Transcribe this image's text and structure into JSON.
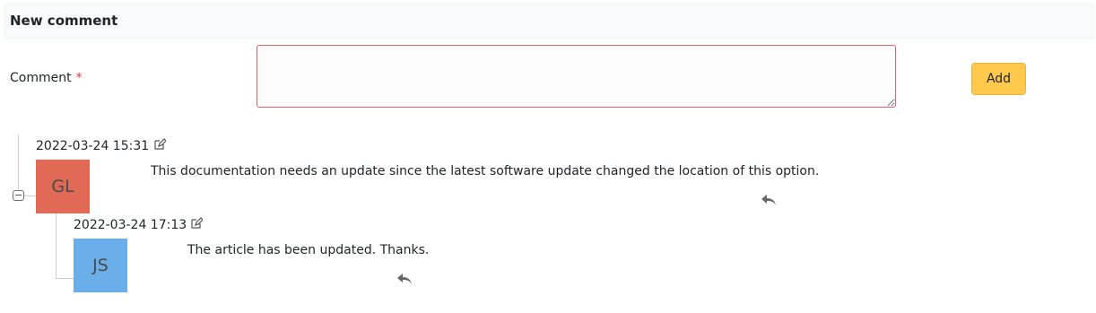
{
  "form": {
    "section_title": "New comment",
    "comment_label": "Comment",
    "required_marker": "*",
    "comment_value": "",
    "add_label": "Add"
  },
  "comments": [
    {
      "timestamp": "2022-03-24 15:31",
      "initials": "GL",
      "avatar_color": "#e06a55",
      "text": "This documentation needs an update since the latest software update changed the location of this option.",
      "icons": [
        "edit-icon",
        "reply-icon"
      ],
      "replies": [
        {
          "timestamp": "2022-03-24 17:13",
          "initials": "JS",
          "avatar_color": "#6aaeea",
          "text": "The article has been updated. Thanks.",
          "icons": [
            "edit-icon",
            "reply-icon"
          ]
        }
      ]
    }
  ],
  "tree": {
    "toggle_icon": "collapse-minus-icon"
  }
}
